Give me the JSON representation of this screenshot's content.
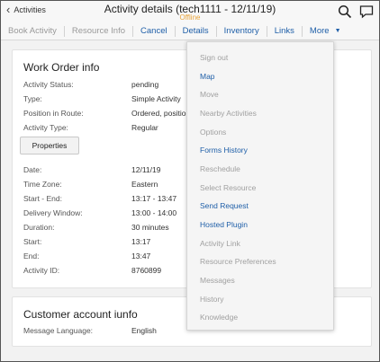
{
  "header": {
    "back_label": "Activities",
    "title": "Activity details (tech1111 - 12/11/19)",
    "status": "Offline"
  },
  "toolbar": {
    "items": [
      {
        "label": "Book Activity",
        "state": "disabled"
      },
      {
        "label": "Resource Info",
        "state": "disabled"
      },
      {
        "label": "Cancel",
        "state": "active"
      },
      {
        "label": "Details",
        "state": "active"
      },
      {
        "label": "Inventory",
        "state": "active"
      },
      {
        "label": "Links",
        "state": "active"
      }
    ],
    "more_label": "More"
  },
  "work_order": {
    "title": "Work Order info",
    "fields": [
      {
        "label": "Activity Status:",
        "value": "pending"
      },
      {
        "label": "Type:",
        "value": "Simple Activity"
      },
      {
        "label": "Position in Route:",
        "value": "Ordered, positio"
      },
      {
        "label": "Activity Type:",
        "value": "Regular"
      }
    ],
    "properties_button": "Properties",
    "fields2": [
      {
        "label": "Date:",
        "value": "12/11/19"
      },
      {
        "label": "Time Zone:",
        "value": "Eastern"
      },
      {
        "label": "Start - End:",
        "value": "13:17 - 13:47"
      },
      {
        "label": "Delivery Window:",
        "value": "13:00 - 14:00"
      },
      {
        "label": "Duration:",
        "value": "30 minutes"
      },
      {
        "label": "Start:",
        "value": "13:17"
      },
      {
        "label": "End:",
        "value": "13:47"
      },
      {
        "label": "Activity ID:",
        "value": "8760899"
      }
    ]
  },
  "customer": {
    "title": "Customer account iunfo",
    "fields": [
      {
        "label": "Message Language:",
        "value": "English"
      }
    ]
  },
  "more_menu": {
    "items": [
      {
        "label": "Sign out",
        "enabled": false
      },
      {
        "label": "Map",
        "enabled": true
      },
      {
        "label": "Move",
        "enabled": false
      },
      {
        "label": "Nearby Activities",
        "enabled": false
      },
      {
        "label": "Options",
        "enabled": false
      },
      {
        "label": "Forms History",
        "enabled": true
      },
      {
        "label": "Reschedule",
        "enabled": false
      },
      {
        "label": "Select Resource",
        "enabled": false
      },
      {
        "label": "Send Request",
        "enabled": true
      },
      {
        "label": "Hosted Plugin",
        "enabled": true
      },
      {
        "label": "Activity Link",
        "enabled": false
      },
      {
        "label": "Resource Preferences",
        "enabled": false
      },
      {
        "label": "Messages",
        "enabled": false
      },
      {
        "label": "History",
        "enabled": false
      },
      {
        "label": "Knowledge",
        "enabled": false
      }
    ]
  },
  "colors": {
    "accent": "#1f5fa8",
    "offline": "#e8a33a",
    "disabled": "#9a9a9a"
  },
  "icons": [
    "chevron-left-icon",
    "search-icon",
    "chat-icon",
    "triangle-down-icon"
  ]
}
